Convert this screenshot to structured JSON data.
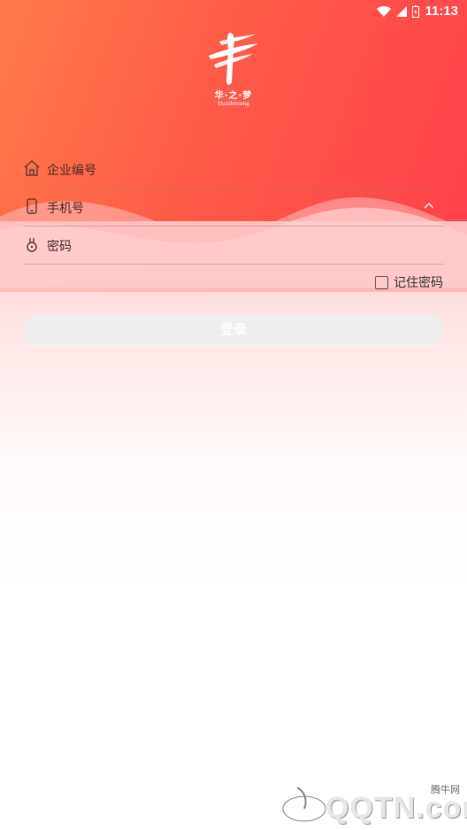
{
  "status_bar": {
    "time": "11:13"
  },
  "brand": {
    "name_cn": "华·之·梦",
    "name_en": "Huazhimeng"
  },
  "form": {
    "company_code": {
      "placeholder": "企业编号",
      "icon": "home-icon"
    },
    "phone": {
      "placeholder": "手机号",
      "icon": "phone-icon"
    },
    "password": {
      "placeholder": "密码",
      "icon": "lock-icon"
    },
    "remember_label": "记住密码",
    "remember_checked": false,
    "login_label": "登录"
  },
  "watermark": {
    "site_cn": "腾牛网",
    "site_en": "QQTN.com"
  },
  "colors": {
    "accent_start": "#ff7a4a",
    "accent_end": "#ff3f4b",
    "button_bg": "#eeeeee"
  }
}
